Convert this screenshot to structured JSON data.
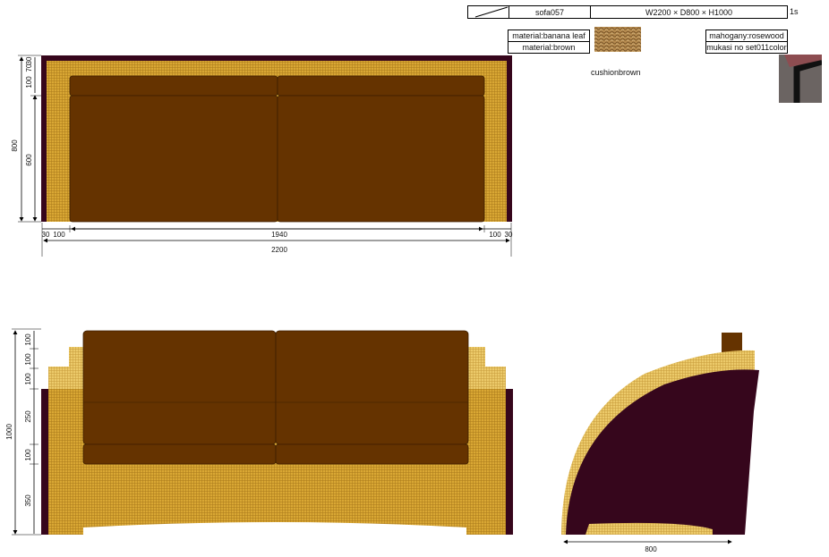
{
  "title_block": {
    "name": "sofa057",
    "size": "W2200 × D800 × H1000",
    "scale": "1s"
  },
  "materials": {
    "frame_material": "material:banana leaf",
    "frame_color": "material:brown",
    "cushion": "cushionbrown",
    "wood_material": "mahogany:rosewood",
    "wood_color": "mukasi no set011color"
  },
  "plan_view": {
    "depth_total": "800",
    "depth_seat": "600",
    "depth_small": [
      "30",
      "70",
      "100"
    ],
    "width_parts": [
      "30",
      "100",
      "1940",
      "100",
      "30"
    ],
    "width_total": "2200"
  },
  "front_view": {
    "height_total": "1000",
    "height_parts": [
      "100",
      "100",
      "100",
      "250",
      "100",
      "350"
    ]
  },
  "side_view": {
    "depth_total": "800"
  },
  "colors": {
    "wicker": "#d9a734",
    "wicker_light": "#eccc6e",
    "cushion": "#653300",
    "frame_dark": "#36061c",
    "dimension_line": "#000000"
  }
}
